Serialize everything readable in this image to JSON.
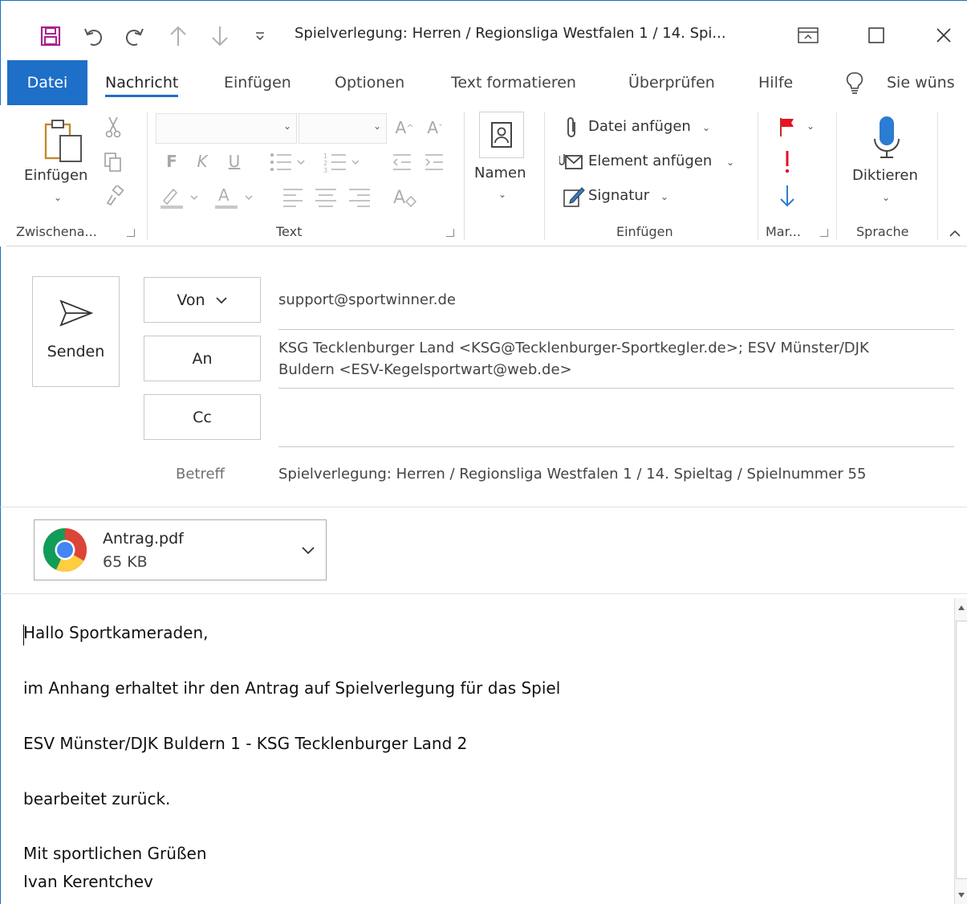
{
  "window": {
    "title": "Spielverlegung: Herren / Regionsliga Westfalen 1 / 14. Spi...",
    "accent_color": "#1e6fc8"
  },
  "quick_access": [
    {
      "name": "save-icon"
    },
    {
      "name": "undo-icon"
    },
    {
      "name": "redo-icon"
    },
    {
      "name": "arrow-up-icon"
    },
    {
      "name": "arrow-down-icon"
    },
    {
      "name": "customize-icon"
    }
  ],
  "tabs": {
    "file": "Datei",
    "message": "Nachricht",
    "insert": "Einfügen",
    "options": "Optionen",
    "format": "Text formatieren",
    "review": "Überprüfen",
    "help": "Hilfe",
    "tell_me": "Sie wüns"
  },
  "ribbon": {
    "clipboard": {
      "paste": "Einfügen",
      "label": "Zwischena..."
    },
    "text": {
      "bold": "F",
      "italic": "K",
      "underline": "U",
      "label": "Text"
    },
    "names": {
      "label": "Namen"
    },
    "include": {
      "attach_file": "Datei anfügen",
      "attach_item": "Element anfügen",
      "signature": "Signatur",
      "label": "Einfügen"
    },
    "tags": {
      "label": "Mar..."
    },
    "voice": {
      "dictate": "Diktieren",
      "label": "Sprache"
    }
  },
  "compose": {
    "send": "Senden",
    "from_button": "Von",
    "from_value": "support@sportwinner.de",
    "to_button": "An",
    "to_value_line1": "KSG Tecklenburger Land <KSG@Tecklenburger-Sportkegler.de>; ESV Münster/DJK",
    "to_value_line2": "Buldern <ESV-Kegelsportwart@web.de>",
    "cc_button": "Cc",
    "cc_value": "",
    "subject_label": "Betreff",
    "subject_value": "Spielverlegung: Herren / Regionsliga Westfalen 1 / 14. Spieltag / Spielnummer 55"
  },
  "attachment": {
    "name": "Antrag.pdf",
    "size": "65 KB"
  },
  "body": {
    "lines": [
      "Hallo Sportkameraden,",
      "im Anhang erhaltet ihr den Antrag auf Spielverlegung für das Spiel",
      "ESV Münster/DJK Buldern 1 - KSG Tecklenburger Land 2",
      "bearbeitet zurück.",
      "Mit sportlichen Grüßen",
      "Ivan Kerentchev"
    ]
  }
}
